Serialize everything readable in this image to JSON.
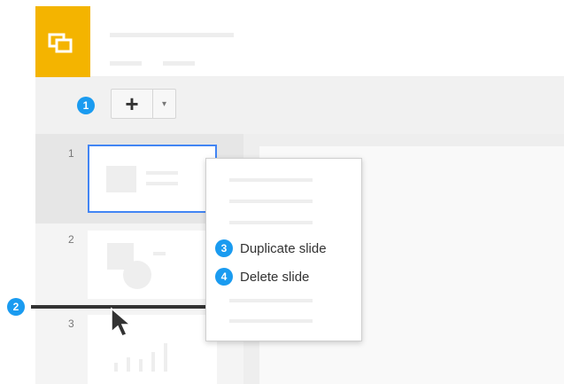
{
  "logo": {
    "icon": "slides-logo-icon",
    "color": "#f4b400"
  },
  "toolbar": {
    "new_slide_symbol": "+",
    "dropdown_symbol": "▾"
  },
  "badges": [
    "1",
    "2",
    "3",
    "4"
  ],
  "slides": [
    {
      "number": "1",
      "selected": true
    },
    {
      "number": "2",
      "selected": false
    },
    {
      "number": "3",
      "selected": false
    }
  ],
  "context_menu": {
    "items": [
      {
        "badge": "3",
        "label": "Duplicate slide"
      },
      {
        "badge": "4",
        "label": "Delete slide"
      }
    ]
  },
  "cursor": {
    "icon": "mouse-pointer-icon"
  },
  "colors": {
    "accent": "#1a9bf0",
    "selection": "#4285f4"
  }
}
